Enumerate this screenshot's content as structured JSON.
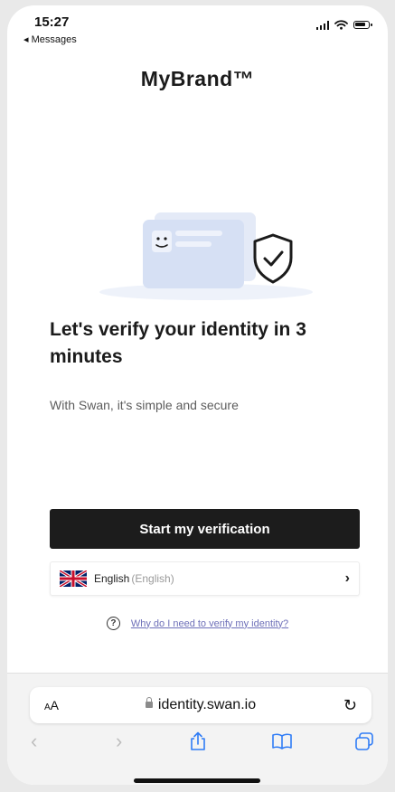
{
  "status_bar": {
    "time": "15:27",
    "back_label": "◂ Messages"
  },
  "brand": "MyBrand™",
  "headline": "Let's verify your identity in 3 minutes",
  "subtitle": "With Swan, it's simple and secure",
  "start_button": "Start my verification",
  "language": {
    "name": "English",
    "native": "(English)",
    "chevron": "›",
    "flag": "uk-flag-icon"
  },
  "help": {
    "icon": "?",
    "link": "Why do I need to verify my identity?"
  },
  "browser": {
    "aa_label": "AA",
    "url": "identity.swan.io",
    "reload": "↻",
    "nav": {
      "back": "‹",
      "forward": "›"
    }
  },
  "colors": {
    "button": "#1c1c1c",
    "link": "#6d6fb8",
    "card": "#dfe6f6",
    "shield": "#1b1b1b"
  }
}
